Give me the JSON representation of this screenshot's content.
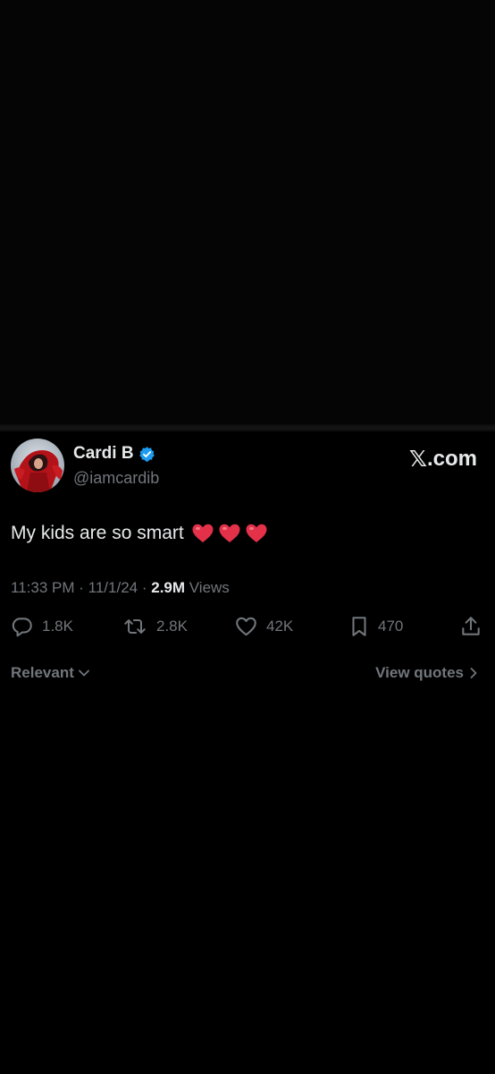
{
  "tweet": {
    "author_name": "Cardi B",
    "handle": "@iamcardib",
    "text": "My kids are so smart",
    "emoji_hearts": [
      "❤️",
      "❤️",
      "❤️"
    ],
    "time": "11:33 PM",
    "date": "11/1/24",
    "views_count": "2.9M",
    "views_label": "Views",
    "separator": "·"
  },
  "brand": {
    "x_glyph": "𝕏",
    "domain": ".com"
  },
  "actions": {
    "replies": "1.8K",
    "reposts": "2.8K",
    "likes": "42K",
    "bookmarks": "470"
  },
  "filters": {
    "sort_label": "Relevant",
    "quotes_label": "View quotes"
  },
  "colors": {
    "background": "#000000",
    "text_primary": "#e7e9ea",
    "text_secondary": "#71767b",
    "verified_blue": "#1d9bf0",
    "heart_red": "#e3314a"
  },
  "icons": {
    "verified": "verified-badge-icon",
    "reply": "speech-bubble-icon",
    "repost": "repost-arrows-icon",
    "like": "heart-outline-icon",
    "bookmark": "bookmark-icon",
    "share": "share-upload-icon",
    "sort": "chevron-down-icon",
    "quotes": "chevron-right-icon"
  }
}
